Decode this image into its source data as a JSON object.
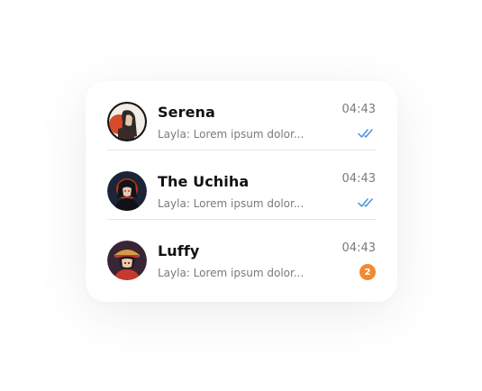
{
  "colors": {
    "read_tick": "#4a90e2",
    "badge": "#f08a33"
  },
  "chats": [
    {
      "name": "Serena",
      "preview": "Layla: Lorem ipsum dolor...",
      "time": "04:43",
      "status": "read",
      "avatar_icon": "serena-avatar"
    },
    {
      "name": "The Uchiha",
      "preview": "Layla: Lorem ipsum dolor...",
      "time": "04:43",
      "status": "read",
      "avatar_icon": "uchiha-avatar"
    },
    {
      "name": "Luffy",
      "preview": "Layla: Lorem ipsum dolor...",
      "time": "04:43",
      "unread_count": "2",
      "avatar_icon": "luffy-avatar"
    }
  ]
}
